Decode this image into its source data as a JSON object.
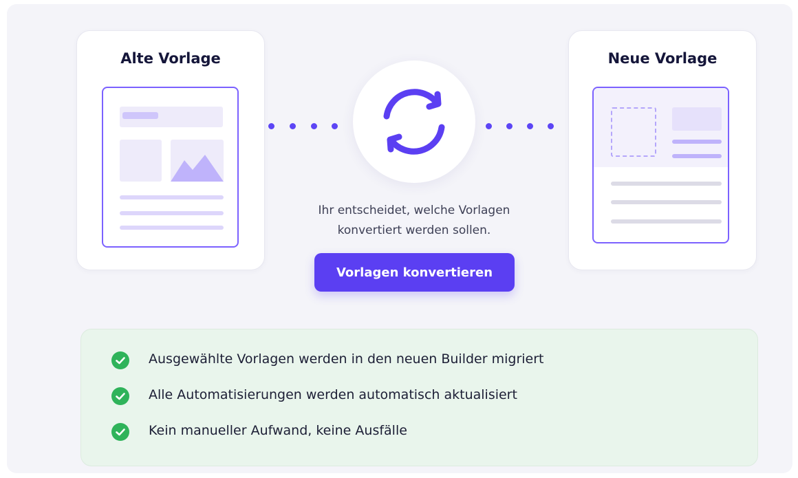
{
  "old_template": {
    "title": "Alte Vorlage"
  },
  "new_template": {
    "title": "Neue Vorlage"
  },
  "sync": {
    "icon": "sync-icon"
  },
  "caption": {
    "line1": "Ihr entscheidet, welche Vorlagen",
    "line2": "konvertiert werden sollen."
  },
  "convert_button": {
    "label": "Vorlagen konvertieren"
  },
  "benefits": [
    {
      "text": "Ausgewählte Vorlagen werden in den neuen Builder migriert",
      "icon": "check-circle-icon"
    },
    {
      "text": "Alle Automatisierungen werden automatisch aktualisiert",
      "icon": "check-circle-icon"
    },
    {
      "text": "Kein manueller Aufwand, keine Ausfälle",
      "icon": "check-circle-icon"
    }
  ],
  "colors": {
    "accent": "#5b3ff2",
    "accent_border": "#7b61ff",
    "success": "#2fb35a",
    "success_bg": "#e9f5ec"
  }
}
